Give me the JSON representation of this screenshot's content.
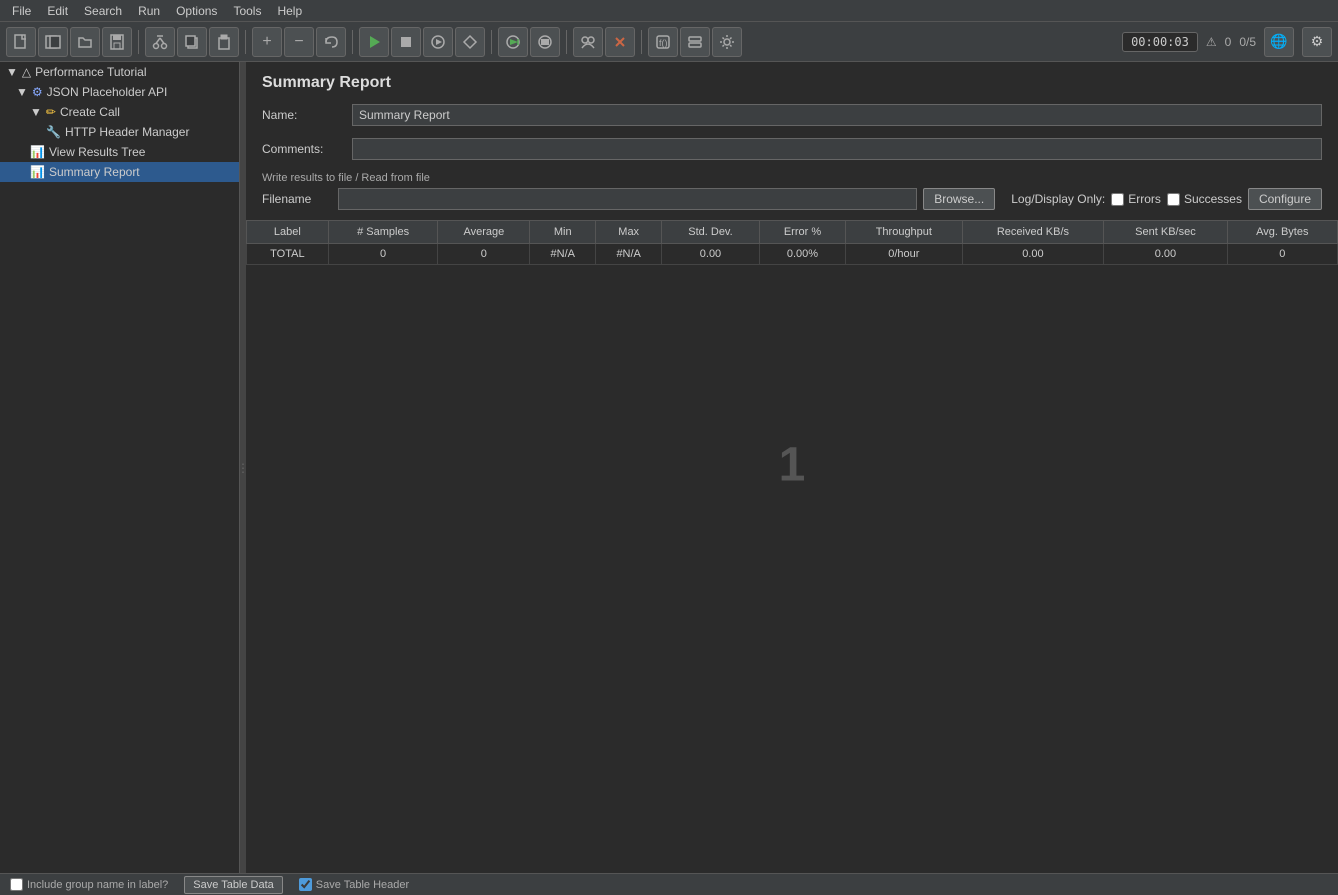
{
  "menubar": {
    "items": [
      "File",
      "Edit",
      "Search",
      "Run",
      "Options",
      "Tools",
      "Help"
    ]
  },
  "toolbar": {
    "timer": "00:00:03",
    "warnings": "0",
    "threads": "0/5",
    "buttons": [
      {
        "name": "new",
        "icon": "☐"
      },
      {
        "name": "open-templates",
        "icon": "⊕"
      },
      {
        "name": "open",
        "icon": "📂"
      },
      {
        "name": "save",
        "icon": "💾"
      },
      {
        "name": "cut",
        "icon": "✂"
      },
      {
        "name": "copy",
        "icon": "⎘"
      },
      {
        "name": "paste",
        "icon": "📋"
      },
      {
        "name": "expand",
        "icon": "+"
      },
      {
        "name": "collapse",
        "icon": "−"
      },
      {
        "name": "undo",
        "icon": "↩"
      },
      {
        "name": "run",
        "icon": "▶"
      },
      {
        "name": "stop",
        "icon": "⬛"
      },
      {
        "name": "start-no-pause",
        "icon": "●"
      },
      {
        "name": "stop-all",
        "icon": "⏹"
      },
      {
        "name": "remote-start",
        "icon": "🌐"
      },
      {
        "name": "remote-stop",
        "icon": "⊗"
      },
      {
        "name": "threads",
        "icon": "⚙"
      },
      {
        "name": "clear",
        "icon": "🗑"
      },
      {
        "name": "function-helper",
        "icon": "ƒ"
      },
      {
        "name": "remote-server",
        "icon": "🌐"
      },
      {
        "name": "options",
        "icon": "⚙"
      }
    ]
  },
  "sidebar": {
    "items": [
      {
        "label": "Performance Tutorial",
        "level": 0,
        "icon": "▷",
        "type": "root"
      },
      {
        "label": "JSON Placeholder API",
        "level": 1,
        "icon": "⚙",
        "type": "config"
      },
      {
        "label": "Create Call",
        "level": 2,
        "icon": "✏",
        "type": "sampler"
      },
      {
        "label": "HTTP Header Manager",
        "level": 3,
        "icon": "🔧",
        "type": "config"
      },
      {
        "label": "View Results Tree",
        "level": 2,
        "icon": "📊",
        "type": "listener"
      },
      {
        "label": "Summary Report",
        "level": 2,
        "icon": "📊",
        "type": "listener",
        "selected": true
      }
    ]
  },
  "main": {
    "panel_title": "Summary Report",
    "name_label": "Name:",
    "name_value": "Summary Report",
    "comments_label": "Comments:",
    "comments_value": "",
    "write_results_label": "Write results to file / Read from file",
    "filename_label": "Filename",
    "filename_value": "",
    "browse_label": "Browse...",
    "log_display_label": "Log/Display Only:",
    "errors_label": "Errors",
    "errors_checked": false,
    "successes_label": "Successes",
    "successes_checked": false,
    "configure_label": "Configure",
    "table": {
      "headers": [
        "Label",
        "# Samples",
        "Average",
        "Min",
        "Max",
        "Std. Dev.",
        "Error %",
        "Throughput",
        "Received KB/s",
        "Sent KB/sec",
        "Avg. Bytes"
      ],
      "rows": [
        {
          "label": "TOTAL",
          "samples": "0",
          "average": "0",
          "min": "#N/A",
          "max": "#N/A",
          "std_dev": "0.00",
          "error_pct": "0.00%",
          "throughput": "0/hour",
          "received_kb": "0.00",
          "sent_kb": "0.00",
          "avg_bytes": "0"
        }
      ]
    },
    "center_number": "1"
  },
  "bottom_bar": {
    "include_group_label": "Include group name in label?",
    "include_group_checked": false,
    "save_table_data_label": "Save Table Data",
    "save_table_header_label": "Save Table Header",
    "save_table_header_checked": true
  },
  "status_bar": {
    "warnings_label": "⚠",
    "warnings_count": "0",
    "threads_label": "0/5"
  }
}
